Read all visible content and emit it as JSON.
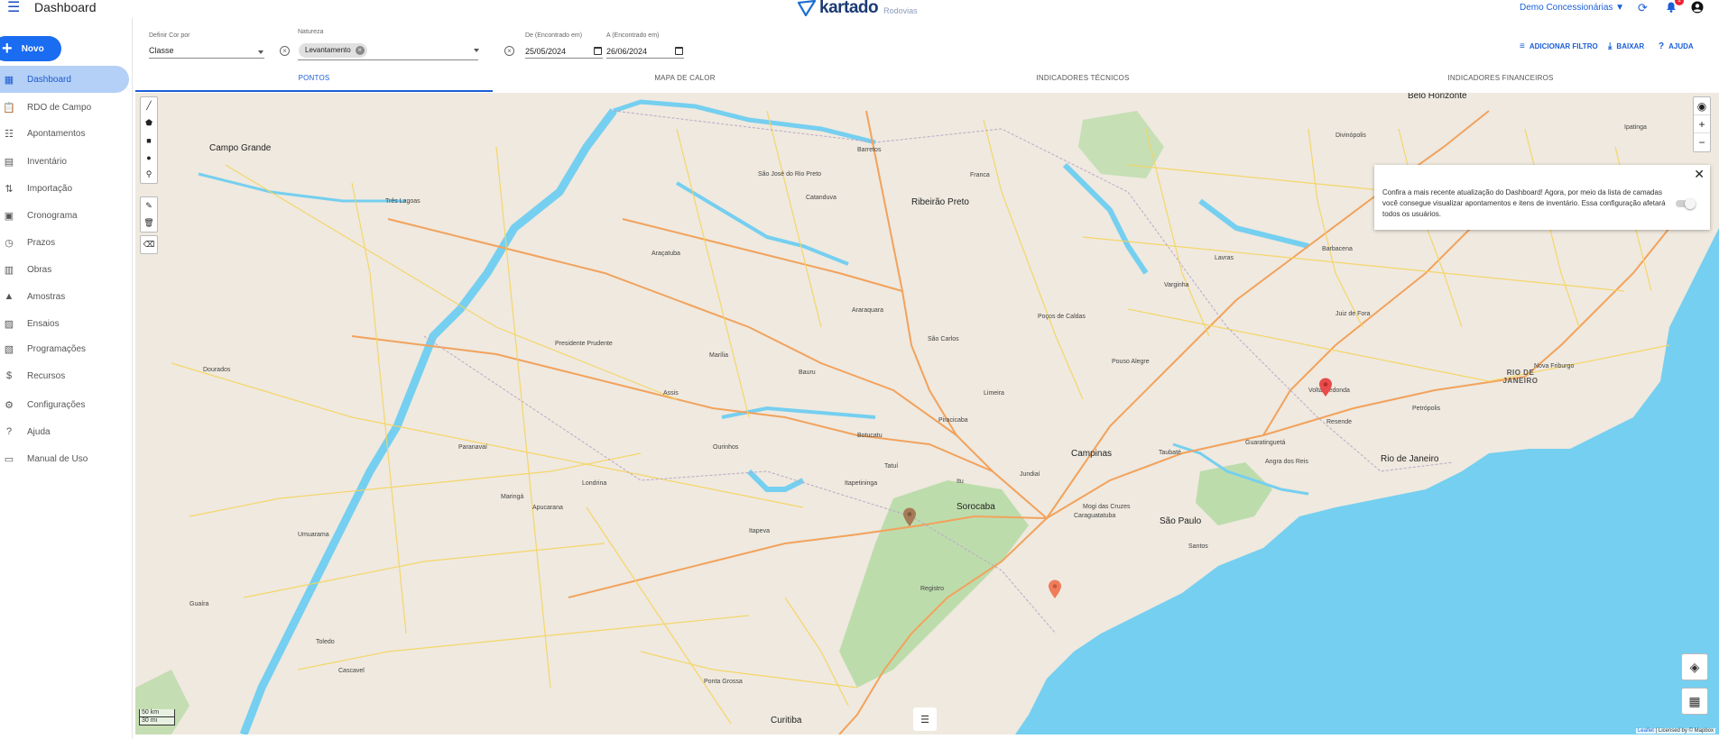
{
  "header": {
    "app_title": "Dashboard",
    "logo_text": "kartado",
    "logo_sub": "Rodovias",
    "tenant": "Demo Concessionárias ▼",
    "notifications_count": "1"
  },
  "sidebar": {
    "new_label": "Novo",
    "items": [
      {
        "label": "Dashboard",
        "icon": "dashboard-icon"
      },
      {
        "label": "RDO de Campo",
        "icon": "clipboard-icon"
      },
      {
        "label": "Apontamentos",
        "icon": "notes-icon"
      },
      {
        "label": "Inventário",
        "icon": "inventory-icon"
      },
      {
        "label": "Importação",
        "icon": "import-icon"
      },
      {
        "label": "Cronograma",
        "icon": "calendar-icon"
      },
      {
        "label": "Prazos",
        "icon": "clock-icon"
      },
      {
        "label": "Obras",
        "icon": "construction-icon"
      },
      {
        "label": "Amostras",
        "icon": "flask-icon"
      },
      {
        "label": "Ensaios",
        "icon": "test-icon"
      },
      {
        "label": "Programações",
        "icon": "schedule-icon"
      },
      {
        "label": "Recursos",
        "icon": "dollar-icon"
      },
      {
        "label": "Configurações",
        "icon": "gear-icon"
      },
      {
        "label": "Ajuda",
        "icon": "help-icon"
      },
      {
        "label": "Manual de Uso",
        "icon": "book-icon"
      }
    ]
  },
  "filters": {
    "color_by_label": "Definir Cor por",
    "color_by_value": "Classe",
    "nature_label": "Natureza",
    "nature_chip": "Levantamento",
    "from_label": "De (Encontrado em)",
    "from_value": "25/05/2024",
    "to_label": "A (Encontrado em)",
    "to_value": "26/06/2024"
  },
  "actions": {
    "add_filter": "ADICIONAR FILTRO",
    "download": "BAIXAR",
    "help": "AJUDA"
  },
  "tabs": [
    {
      "label": "PONTOS"
    },
    {
      "label": "MAPA DE CALOR"
    },
    {
      "label": "INDICADORES TÉCNICOS"
    },
    {
      "label": "INDICADORES FINANCEIROS"
    }
  ],
  "map": {
    "popup_text": "Confira a mais recente atualização do Dashboard! Agora, por meio da lista de camadas você consegue visualizar apontamentos e itens de inventário. Essa configuração afetará todos os usuários.",
    "zoom_in": "+",
    "zoom_out": "−",
    "scale_top": "50 km",
    "scale_bottom": "30 mi",
    "attribution_leaflet": "Leaflet",
    "attribution_rest": "| Licensed by © Mapbox",
    "cities": [
      {
        "name": "São Paulo",
        "big": true
      },
      {
        "name": "Rio de Janeiro",
        "big": true
      },
      {
        "name": "Campinas",
        "big": true
      },
      {
        "name": "Sorocaba",
        "big": true
      },
      {
        "name": "Belo Horizonte",
        "big": true
      },
      {
        "name": "Campo Grande",
        "big": true
      },
      {
        "name": "Ribeirão Preto",
        "big": true
      },
      {
        "name": "Curitiba",
        "big": true
      },
      {
        "name": "Bauru"
      },
      {
        "name": "Marília"
      },
      {
        "name": "Presidente Prudente"
      },
      {
        "name": "Araçatuba"
      },
      {
        "name": "São José do Rio Preto"
      },
      {
        "name": "Araraquara"
      },
      {
        "name": "São Carlos"
      },
      {
        "name": "Piracicaba"
      },
      {
        "name": "Jundiaí"
      },
      {
        "name": "Limeira"
      },
      {
        "name": "Botucatu"
      },
      {
        "name": "Ourinhos"
      },
      {
        "name": "Londrina"
      },
      {
        "name": "Maringá"
      },
      {
        "name": "Apucarana"
      },
      {
        "name": "Umuarama"
      },
      {
        "name": "Paranavaí"
      },
      {
        "name": "Ponta Grossa"
      },
      {
        "name": "Itapeva"
      },
      {
        "name": "Registro"
      },
      {
        "name": "Taubaté"
      },
      {
        "name": "Caraguatatuba"
      },
      {
        "name": "Mogi das Cruzes"
      },
      {
        "name": "Franca"
      },
      {
        "name": "Varginha"
      },
      {
        "name": "Lavras"
      },
      {
        "name": "Barbacena"
      },
      {
        "name": "Juiz de Fora"
      },
      {
        "name": "Volta Redonda"
      },
      {
        "name": "Petrópolis"
      },
      {
        "name": "Poços de Caldas"
      },
      {
        "name": "Pouso Alegre"
      },
      {
        "name": "Três Lagoas"
      },
      {
        "name": "Dourados"
      },
      {
        "name": "Guaíra"
      },
      {
        "name": "Toledo"
      },
      {
        "name": "Cascavel"
      },
      {
        "name": "Divinópolis"
      },
      {
        "name": "Ipatinga"
      },
      {
        "name": "Angra dos Reis"
      },
      {
        "name": "Nova Friburgo"
      },
      {
        "name": "Tatuí"
      },
      {
        "name": "Itu"
      },
      {
        "name": "Itapetininga"
      },
      {
        "name": "Assis"
      },
      {
        "name": "Catanduva"
      },
      {
        "name": "Barretos"
      },
      {
        "name": "Santos"
      },
      {
        "name": "Guaratinguetá"
      },
      {
        "name": "Resende"
      }
    ],
    "regions": [
      {
        "name": "RIO DE JANEIRO"
      }
    ]
  }
}
